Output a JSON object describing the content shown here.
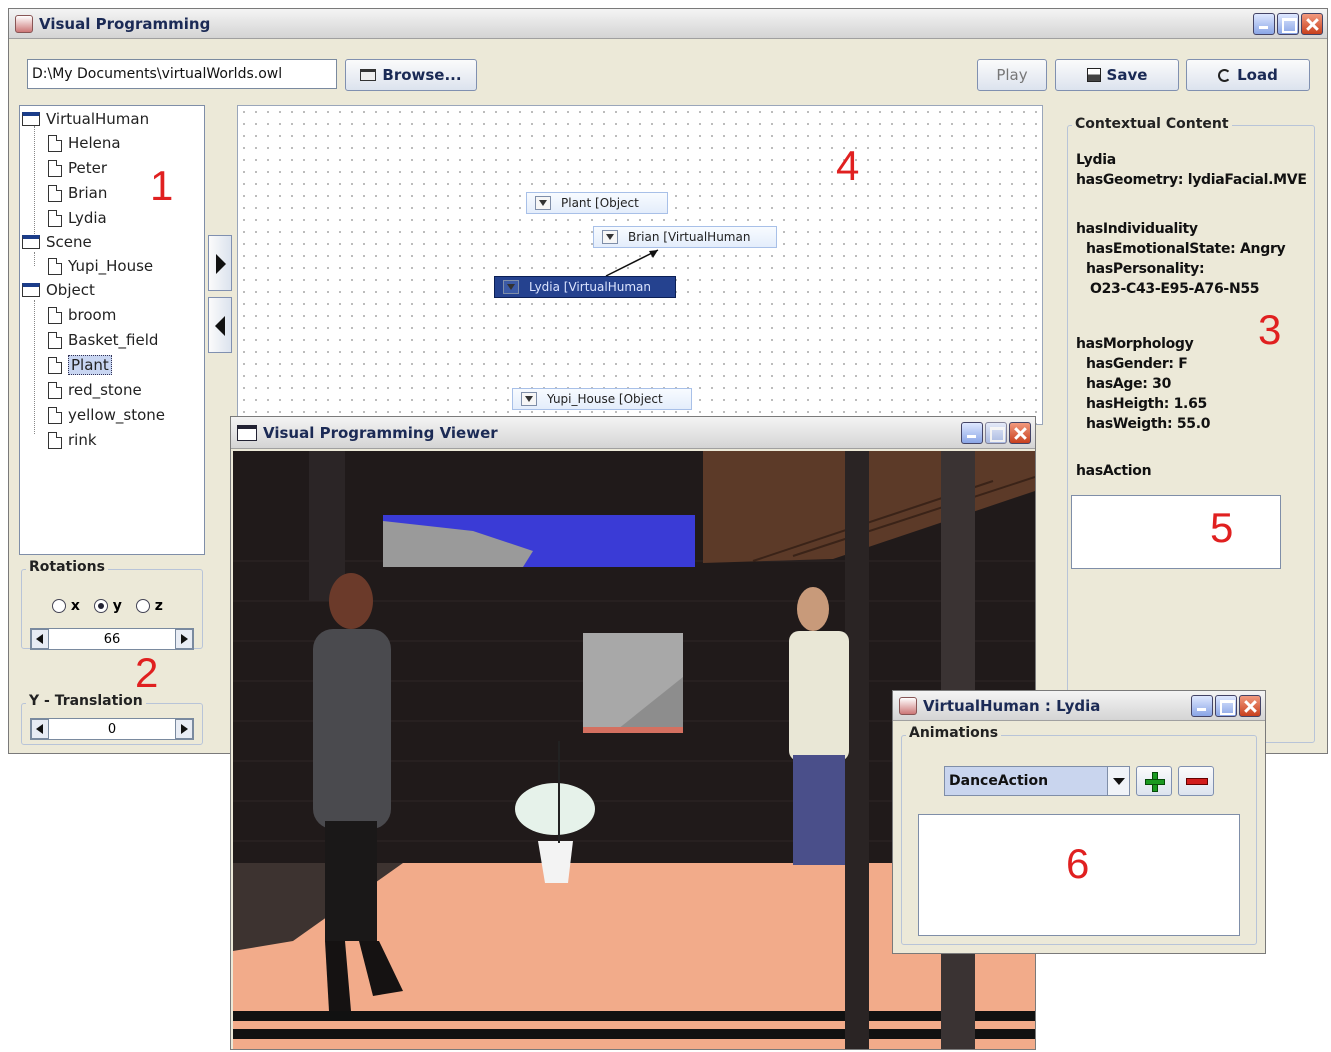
{
  "main_window": {
    "title": "Visual Programming",
    "file_path": "D:\\My Documents\\virtualWorlds.owl",
    "browse_label": "Browse...",
    "play_label": "Play",
    "save_label": "Save",
    "load_label": "Load"
  },
  "tree": {
    "categories": [
      {
        "label": "VirtualHuman",
        "items": [
          "Helena",
          "Peter",
          "Brian",
          "Lydia"
        ]
      },
      {
        "label": "Scene",
        "items": [
          "Yupi_House"
        ]
      },
      {
        "label": "Object",
        "items": [
          "broom",
          "Basket_field",
          "Plant",
          "red_stone",
          "yellow_stone",
          "rink"
        ]
      }
    ],
    "selected_item": "Plant"
  },
  "rotations": {
    "label": "Rotations",
    "axes": [
      "x",
      "y",
      "z"
    ],
    "selected_axis": "y",
    "value": "66"
  },
  "y_translation": {
    "label": "Y - Translation",
    "value": "0"
  },
  "canvas_nodes": [
    {
      "label": "Plant [Object"
    },
    {
      "label": "Brian [VirtualHuman"
    },
    {
      "label": "Lydia [VirtualHuman"
    },
    {
      "label": "Yupi_House [Object"
    }
  ],
  "contextual_content": {
    "title": "Contextual Content",
    "name": "Lydia",
    "geometry": "hasGeometry: lydiaFacial.MVE",
    "individuality": "hasIndividuality",
    "emotional_state": "hasEmotionalState: Angry",
    "personality": "hasPersonality:",
    "personality_value": "O23-C43-E95-A76-N55",
    "morphology": "hasMorphology",
    "gender": "hasGender: F",
    "age": "hasAge: 30",
    "height": "hasHeigth: 1.65",
    "weight": "hasWeigth: 55.0",
    "action": "hasAction"
  },
  "viewer_window": {
    "title": "Visual Programming Viewer"
  },
  "vh_window": {
    "title": "VirtualHuman : Lydia",
    "animations_label": "Animations",
    "selected_animation": "DanceAction"
  },
  "region_labels": [
    "1",
    "2",
    "3",
    "4",
    "5",
    "6"
  ]
}
